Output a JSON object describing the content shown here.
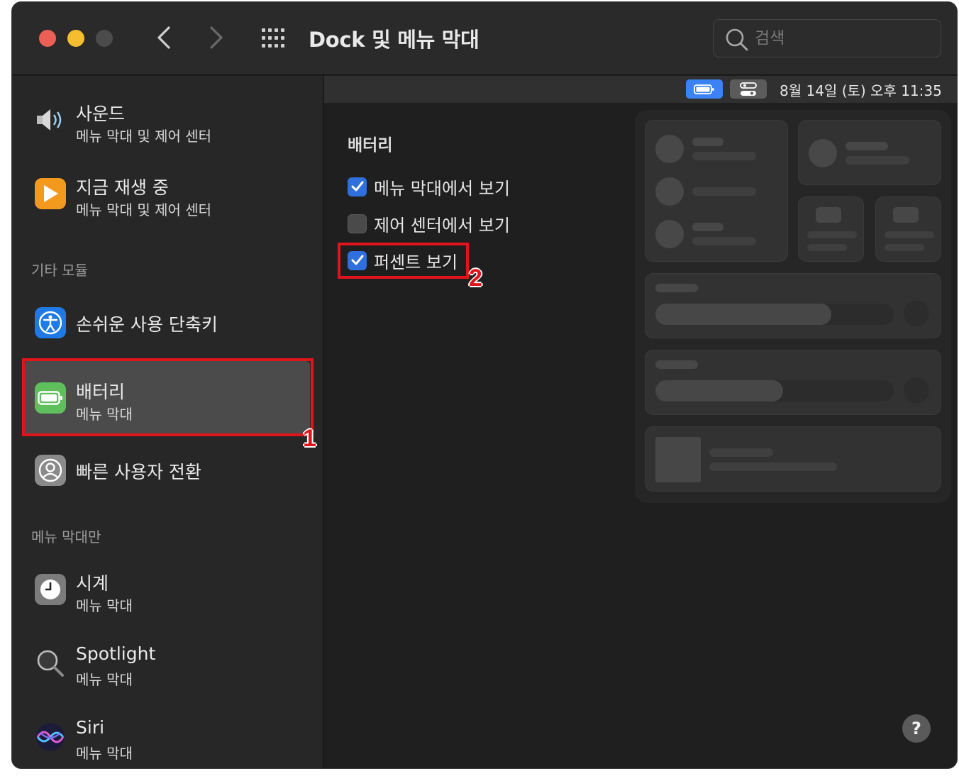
{
  "window": {
    "title": "Dock 및 메뉴 막대",
    "search_placeholder": "검색"
  },
  "menubar_preview": {
    "clock": "8월 14일 (토) 오후  11:35"
  },
  "sidebar": {
    "items": [
      {
        "title": "사운드",
        "subtitle": "메뉴 막대 및 제어 센터",
        "icon": "speaker-icon"
      },
      {
        "title": "지금 재생 중",
        "subtitle": "메뉴 막대 및 제어 센터",
        "icon": "play-icon"
      },
      {
        "title": "손쉬운 사용 단축키",
        "subtitle": "",
        "icon": "accessibility-icon"
      },
      {
        "title": "배터리",
        "subtitle": "메뉴 막대",
        "icon": "battery-icon"
      },
      {
        "title": "빠른 사용자 전환",
        "subtitle": "",
        "icon": "user-icon"
      },
      {
        "title": "시계",
        "subtitle": "메뉴 막대",
        "icon": "clock-icon"
      },
      {
        "title": "Spotlight",
        "subtitle": "메뉴 막대",
        "icon": "spotlight-icon"
      },
      {
        "title": "Siri",
        "subtitle": "메뉴 막대",
        "icon": "siri-icon"
      }
    ],
    "sections": {
      "other_modules": "기타 모듈",
      "menubar_only": "메뉴 막대만"
    }
  },
  "battery_settings": {
    "section_title": "배터리",
    "options": [
      {
        "label": "메뉴 막대에서 보기",
        "checked": true
      },
      {
        "label": "제어 센터에서 보기",
        "checked": false
      },
      {
        "label": "퍼센트 보기",
        "checked": true
      }
    ]
  },
  "help_label": "?",
  "annotations": {
    "marker_1": "1",
    "marker_2": "2"
  },
  "colors": {
    "accent": "#2f6fde",
    "annotation": "#e0141b",
    "battery_green": "#65c466"
  }
}
